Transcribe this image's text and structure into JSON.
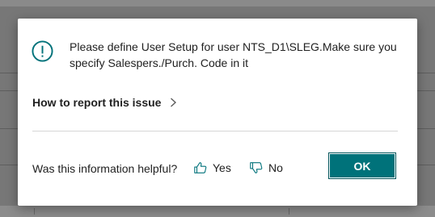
{
  "dialog": {
    "message": "Please define User Setup for user NTS_D1\\SLEG.Make sure you specify Salespers./Purch. Code in it",
    "report_link_label": "How to report this issue",
    "helpful_question": "Was this information helpful?",
    "yes_label": "Yes",
    "no_label": "No",
    "ok_label": "OK"
  },
  "colors": {
    "accent": "#00727a",
    "icon": "#00727a",
    "overlay": "#777777"
  },
  "icons": {
    "info": "info-circle-icon",
    "chevron": "chevron-right-icon",
    "thumbs_up": "thumbs-up-icon",
    "thumbs_down": "thumbs-down-icon"
  }
}
